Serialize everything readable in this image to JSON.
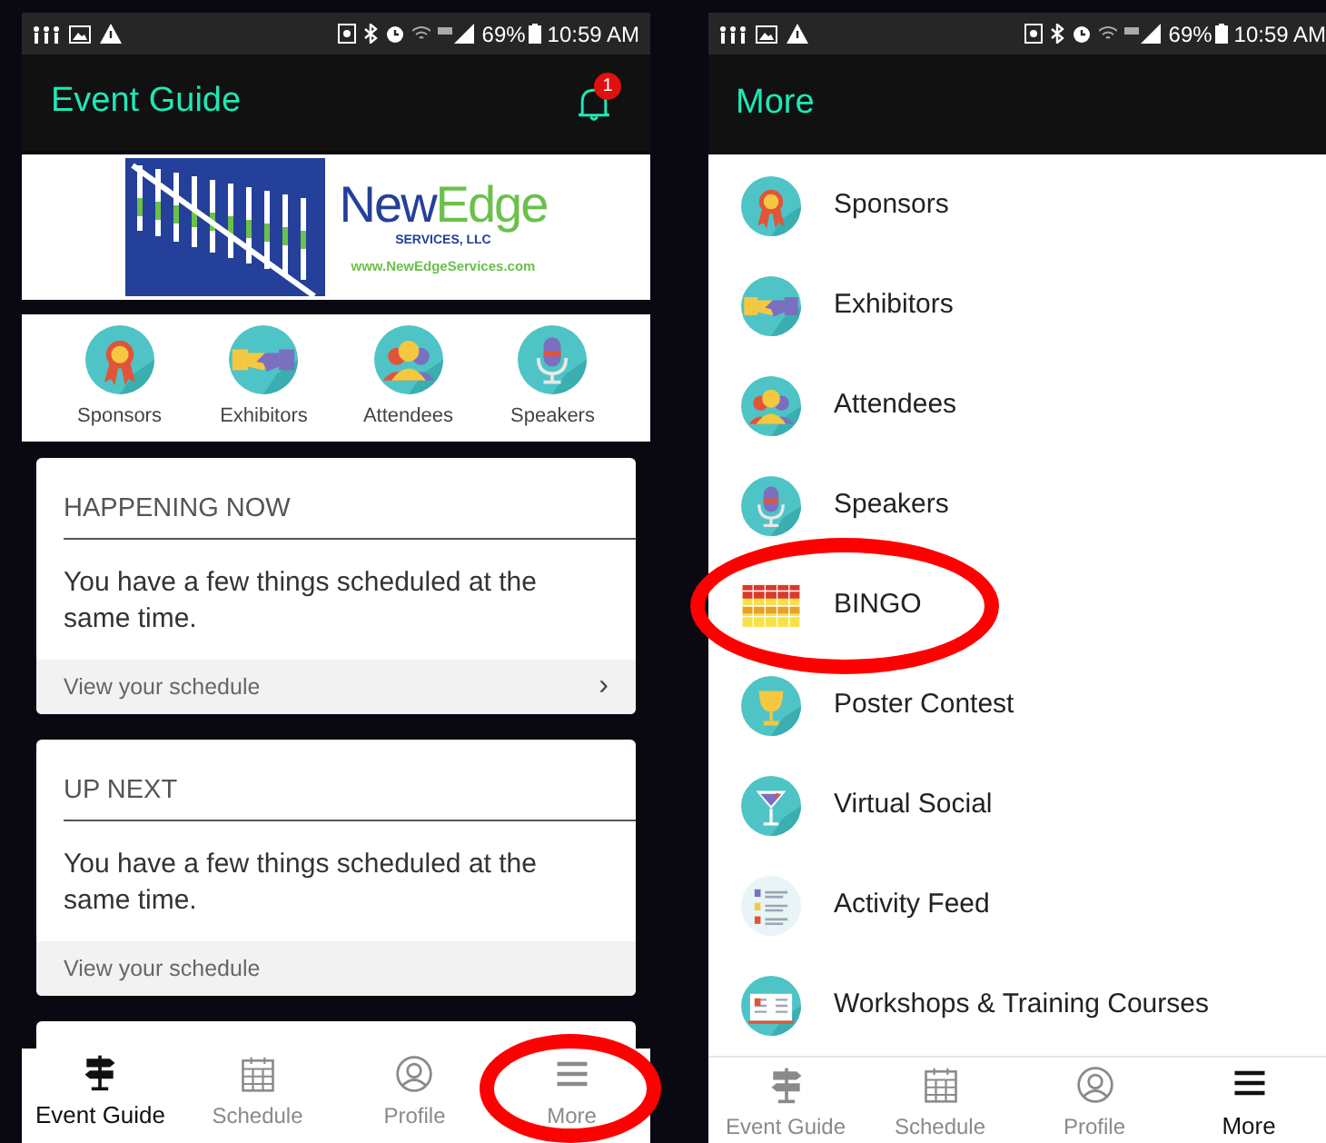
{
  "left_screen": {
    "status_bar": {
      "battery": "69%",
      "time": "10:59 AM"
    },
    "app_bar": {
      "title": "Event Guide",
      "notification_count": "1"
    },
    "banner": {
      "words": [
        "New",
        "Edge"
      ],
      "subtitle": "SERVICES, LLC",
      "url": "www.NewEdgeServices.com"
    },
    "quick_links": [
      {
        "kind": "ribbon",
        "label": "Sponsors"
      },
      {
        "kind": "handshake",
        "label": "Exhibitors"
      },
      {
        "kind": "person",
        "label": "Attendees"
      },
      {
        "kind": "microphone",
        "label": "Speakers"
      }
    ],
    "cards": [
      {
        "heading": "HAPPENING NOW",
        "body": "You have a few things scheduled at the same time.",
        "link": "View your schedule",
        "chevron": "›"
      },
      {
        "heading": "UP NEXT",
        "body": "You have a few things scheduled at the same time.",
        "link": "View your schedule"
      }
    ],
    "nav": [
      {
        "kind": "signpost",
        "label": "Event Guide",
        "selected": true,
        "circled": false
      },
      {
        "kind": "calendar",
        "label": "Schedule",
        "selected": false,
        "circled": false
      },
      {
        "kind": "profile",
        "label": "Profile",
        "selected": false,
        "circled": false
      },
      {
        "kind": "menu",
        "label": "More",
        "selected": false,
        "circled": true
      }
    ]
  },
  "right_screen": {
    "status_bar": {
      "battery": "69%",
      "time": "10:59 AM"
    },
    "app_bar": {
      "title": "More"
    },
    "items": [
      {
        "kind": "ribbon",
        "label": "Sponsors",
        "circled": false
      },
      {
        "kind": "handshake",
        "label": "Exhibitors",
        "circled": false
      },
      {
        "kind": "person",
        "label": "Attendees",
        "circled": false
      },
      {
        "kind": "microphone",
        "label": "Speakers",
        "circled": false
      },
      {
        "kind": "bingo",
        "label": "BINGO",
        "circled": true
      },
      {
        "kind": "trophy",
        "label": "Poster Contest",
        "circled": false
      },
      {
        "kind": "cocktail",
        "label": "Virtual Social",
        "circled": false
      },
      {
        "kind": "feed",
        "label": "Activity Feed",
        "circled": false
      },
      {
        "kind": "book",
        "label": "Workshops & Training Courses",
        "circled": false
      }
    ],
    "nav": [
      {
        "kind": "signpost",
        "label": "Event Guide",
        "selected": false
      },
      {
        "kind": "calendar",
        "label": "Schedule",
        "selected": false
      },
      {
        "kind": "profile",
        "label": "Profile",
        "selected": false
      },
      {
        "kind": "menu",
        "label": "More",
        "selected": true
      }
    ]
  }
}
